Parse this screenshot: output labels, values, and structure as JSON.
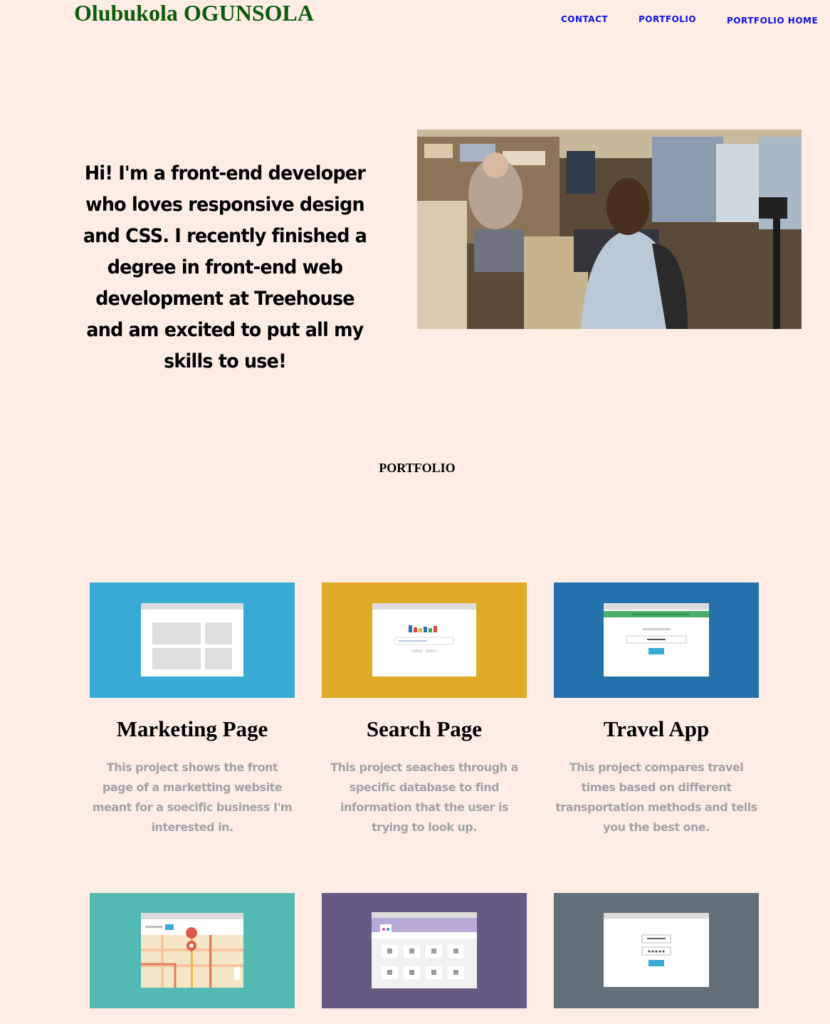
{
  "header": {
    "site_name": "Olubukola OGUNSOLA",
    "nav": [
      {
        "label": "CONTACT"
      },
      {
        "label": "PORTFOLIO"
      },
      {
        "label": "PORTFOLIO HOME"
      }
    ]
  },
  "intro": {
    "text": "Hi! I'm a front-end developer who loves responsive design and CSS. I recently finished a degree in front-end web development at Treehouse and am excited to put all my skills to use!"
  },
  "portfolio": {
    "heading": "PORTFOLIO",
    "projects": [
      {
        "title": "Marketing Page",
        "description": "This project shows the front page of a marketting website meant for a soecific business I'm interested in.",
        "color": "#37abd4"
      },
      {
        "title": "Search Page",
        "description": "This project seaches through a specific database to find information that the user is trying to look up.",
        "color": "#e0a928"
      },
      {
        "title": "Travel App",
        "description": "This project compares travel times based on different transportation methods and tells you the best one.",
        "color": "#2471ac"
      },
      {
        "title": "",
        "description": "",
        "color": "#52bab2"
      },
      {
        "title": "",
        "description": "",
        "color": "#665a85"
      },
      {
        "title": "",
        "description": "",
        "color": "#637079"
      }
    ]
  },
  "colors": {
    "background": "#feede5",
    "site_name": "#0c5c0c",
    "nav_link": "#1010e6",
    "description": "#a3a3a3"
  }
}
